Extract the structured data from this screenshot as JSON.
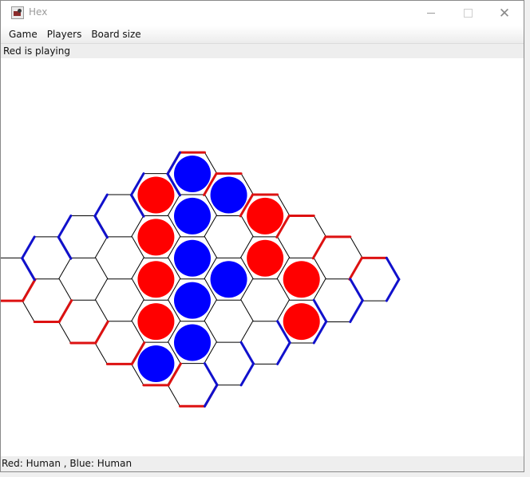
{
  "window": {
    "title": "Hex"
  },
  "menu": [
    "Game",
    "Players",
    "Board size"
  ],
  "status_top": "Red is playing",
  "status_bottom": "Red: Human , Blue: Human",
  "colors": {
    "red": "#ff0000",
    "blue": "#0000ff",
    "red_border": "#dd1111",
    "blue_border": "#1111cc",
    "grid": "#000000"
  },
  "board": {
    "size": 6,
    "stones": [
      {
        "color": "blue",
        "row": 0,
        "col": 0
      },
      {
        "color": "red",
        "row": 1,
        "col": 0
      },
      {
        "color": "blue",
        "row": 1,
        "col": 1
      },
      {
        "color": "red",
        "row": 2,
        "col": 1
      },
      {
        "color": "blue",
        "row": 2,
        "col": 2
      },
      {
        "color": "red",
        "row": 3,
        "col": 2
      },
      {
        "color": "blue",
        "row": 3,
        "col": 3
      },
      {
        "color": "red",
        "row": 4,
        "col": 3
      },
      {
        "color": "blue",
        "row": 4,
        "col": 4
      },
      {
        "color": "blue",
        "row": 5,
        "col": 4
      },
      {
        "color": "red",
        "row": 1,
        "col": 3
      },
      {
        "color": "blue",
        "row": 2,
        "col": 3
      },
      {
        "color": "red",
        "row": 1,
        "col": 4
      },
      {
        "color": "red",
        "row": 2,
        "col": 5
      },
      {
        "color": "blue",
        "row": 0,
        "col": 1
      },
      {
        "color": "red",
        "row": 0,
        "col": 2
      }
    ]
  }
}
